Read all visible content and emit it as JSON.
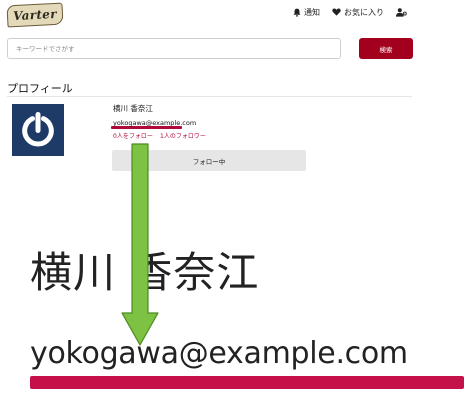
{
  "app": {
    "logo_text": "Varter"
  },
  "header": {
    "nav": [
      {
        "label": "通知",
        "icon": "bell-icon"
      },
      {
        "label": "お気に入り",
        "icon": "heart-icon"
      },
      {
        "label": "",
        "icon": "user-settings-icon"
      }
    ]
  },
  "search": {
    "placeholder": "キーワードでさがす",
    "button_label": "検索"
  },
  "profile": {
    "section_title": "プロフィール",
    "name": "横川 香奈江",
    "email": "yokogawa@example.com",
    "following": "0人をフォロー",
    "followers": "1人のフォロワー",
    "follow_button": "フォロー中"
  },
  "callout": {
    "name": "横川 香奈江",
    "email": "yokogawa@example.com"
  },
  "colors": {
    "accent": "#a3001e",
    "highlight": "#c4114a",
    "arrow": "#7dc242",
    "avatar_bg": "#1e3a66"
  }
}
